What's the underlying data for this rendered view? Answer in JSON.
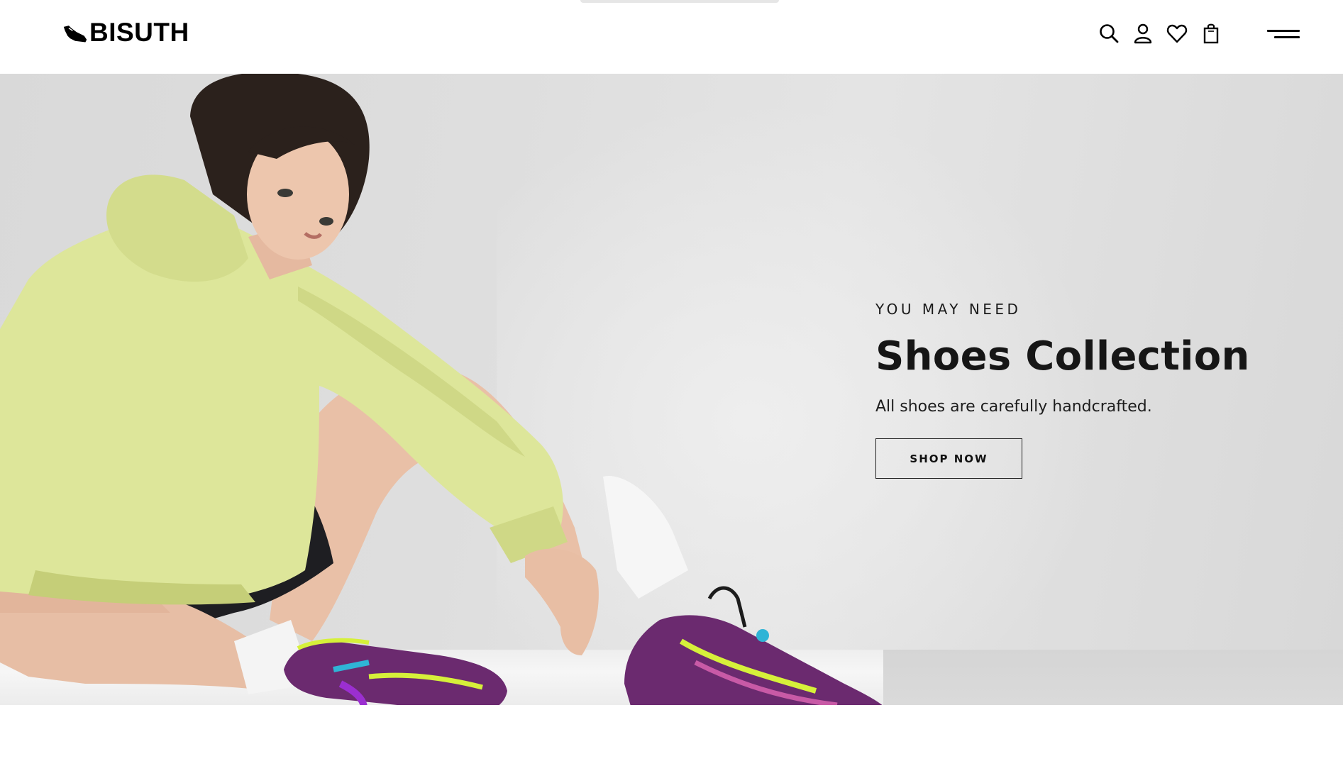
{
  "header": {
    "logo_text": "BISUTH",
    "icons": [
      "search-icon",
      "user-icon",
      "heart-icon",
      "bag-icon",
      "menu-icon"
    ]
  },
  "hero": {
    "eyebrow": "YOU MAY NEED",
    "title": "Shoes Collection",
    "subtitle": "All shoes are carefully handcrafted.",
    "cta_label": "SHOP NOW"
  },
  "colors": {
    "text": "#111111",
    "hero_bg": "#dedede",
    "hoodie": "#dde69a",
    "shoe_purple": "#6a2a6e",
    "shoe_neon": "#d8f02a"
  }
}
